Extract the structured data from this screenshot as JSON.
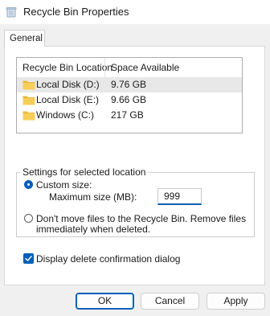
{
  "window": {
    "title": "Recycle Bin Properties"
  },
  "tabs": [
    {
      "label": "General"
    }
  ],
  "list": {
    "columns": {
      "location": "Recycle Bin Location",
      "space": "Space Available"
    },
    "rows": [
      {
        "name": "Local Disk (D:)",
        "space": "9.76 GB",
        "selected": true
      },
      {
        "name": "Local Disk (E:)",
        "space": "9.66 GB",
        "selected": false
      },
      {
        "name": "Windows (C:)",
        "space": "217 GB",
        "selected": false
      }
    ]
  },
  "settings": {
    "group_title": "Settings for selected location",
    "custom_size_label": "Custom size:",
    "max_size_label": "Maximum size (MB):",
    "max_size_value": "999",
    "no_recycle_line1": "Don't move files to the Recycle Bin. Remove files",
    "no_recycle_line2": "immediately when deleted.",
    "selected_option": "custom_size"
  },
  "confirm": {
    "label": "Display delete confirmation dialog",
    "checked": true
  },
  "buttons": {
    "ok": "OK",
    "cancel": "Cancel",
    "apply": "Apply"
  },
  "colors": {
    "accent": "#005fb8",
    "folder": "#f4c84a",
    "window_bg": "#f0f0f0",
    "selected_row": "#e8e8e8"
  },
  "icons": {
    "title": "recycle-bin-icon",
    "drive": "folder-icon",
    "check": "checkmark-icon"
  }
}
